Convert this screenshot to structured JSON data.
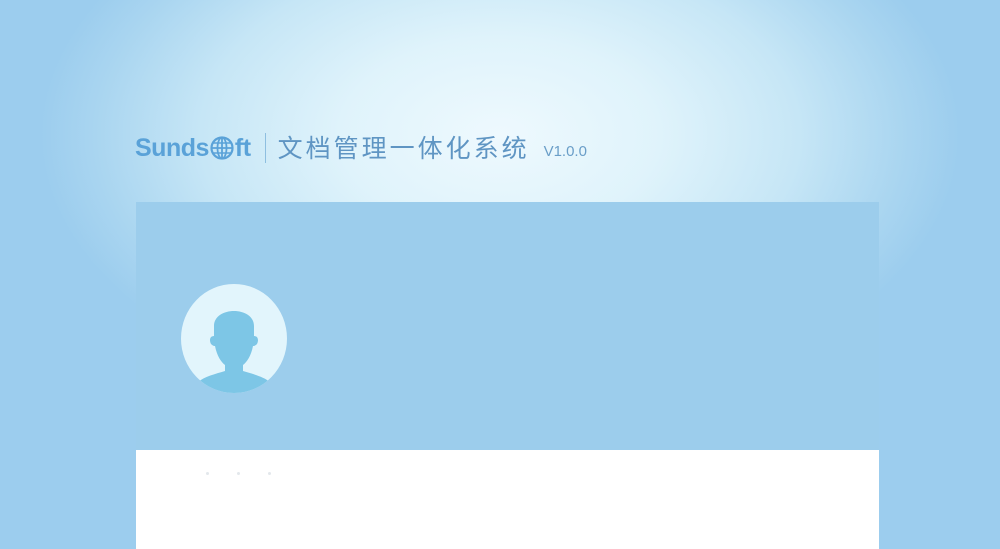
{
  "header": {
    "brand_left": "Sunds",
    "brand_right": "ft",
    "brand_icon": "globe-icon",
    "title": "文档管理一体化系统",
    "version": "V1.0.0"
  },
  "login_card": {
    "avatar_icon": "user-avatar-icon"
  },
  "colors": {
    "brand": "#5aa2d8",
    "title": "#5f95c3",
    "card_top": "#9ccdec",
    "avatar_bg": "#e2f5fc",
    "avatar_silhouette": "#7dc6e6"
  }
}
